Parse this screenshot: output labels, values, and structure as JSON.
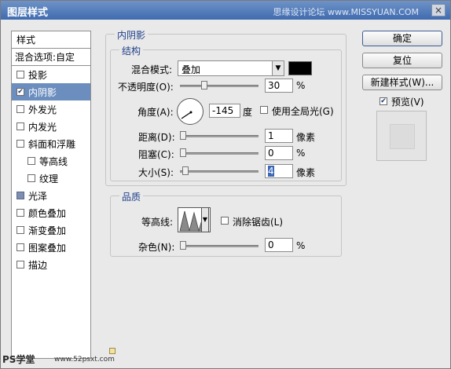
{
  "window": {
    "title": "图层样式",
    "watermark": "思缘设计论坛 www.MISSYUAN.COM",
    "close_label": "×"
  },
  "sidebar": {
    "header": "样式",
    "blend": "混合选项:自定",
    "items": [
      {
        "label": "投影",
        "checked": false
      },
      {
        "label": "内阴影",
        "checked": true
      },
      {
        "label": "外发光",
        "checked": false
      },
      {
        "label": "内发光",
        "checked": false
      },
      {
        "label": "斜面和浮雕",
        "checked": false
      },
      {
        "label": "等高线",
        "checked": false
      },
      {
        "label": "纹理",
        "checked": false
      },
      {
        "label": "光泽",
        "checked": false
      },
      {
        "label": "颜色叠加",
        "checked": false
      },
      {
        "label": "渐变叠加",
        "checked": false
      },
      {
        "label": "图案叠加",
        "checked": false
      },
      {
        "label": "描边",
        "checked": false
      }
    ]
  },
  "inner_shadow": {
    "section_title": "内阴影",
    "structure_title": "结构",
    "blend_mode_label": "混合模式:",
    "blend_mode_value": "叠加",
    "blend_color": "#000000",
    "opacity_label": "不透明度(O):",
    "opacity_value": "30",
    "opacity_unit": "%",
    "angle_label": "角度(A):",
    "angle_value": "-145",
    "angle_unit": "度",
    "global_light_label": "使用全局光(G)",
    "distance_label": "距离(D):",
    "distance_value": "1",
    "distance_unit": "像素",
    "choke_label": "阻塞(C):",
    "choke_value": "0",
    "choke_unit": "%",
    "size_label": "大小(S):",
    "size_value": "4",
    "size_unit": "像素"
  },
  "quality": {
    "title": "品质",
    "contour_label": "等高线:",
    "antialias_label": "消除锯齿(L)",
    "noise_label": "杂色(N):",
    "noise_value": "0",
    "noise_unit": "%"
  },
  "buttons": {
    "ok": "确定",
    "reset": "复位",
    "new_style": "新建样式(W)...",
    "preview_label": "预览(V)"
  },
  "footer": {
    "logo": "PS学堂",
    "url": "www.52psxt.com"
  }
}
